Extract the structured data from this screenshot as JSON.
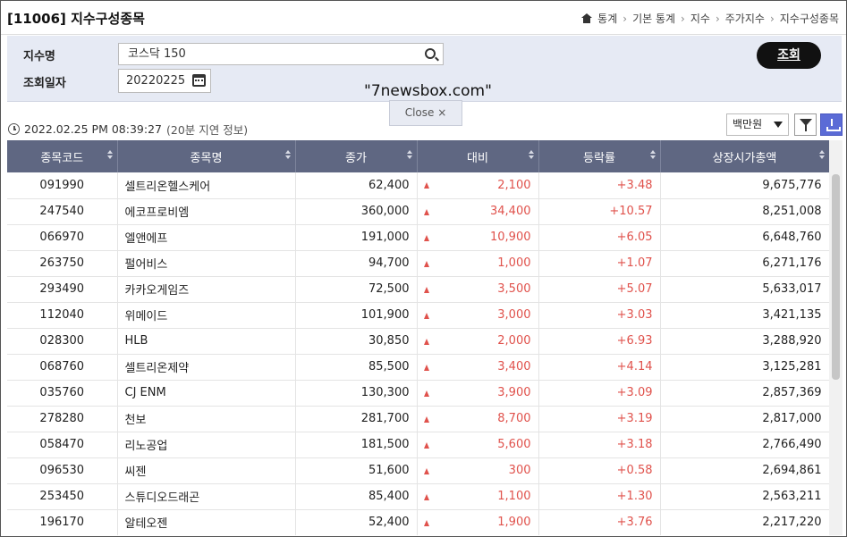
{
  "header": {
    "title": "[11006] 지수구성종목",
    "breadcrumb": [
      "통계",
      "기본 통계",
      "지수",
      "주가지수",
      "지수구성종목"
    ]
  },
  "search": {
    "index_label": "지수명",
    "index_value": "코스닥 150",
    "date_label": "조회일자",
    "date_value": "20220225",
    "query_button": "조회"
  },
  "overlay": {
    "watermark": "\"7newsbox.com\"",
    "close_label": "Close ×"
  },
  "toolbar": {
    "timestamp": "2022.02.25 PM 08:39:27",
    "delay_note": "(20분 지연 정보)",
    "unit_value": "백만원"
  },
  "table": {
    "columns": [
      "종목코드",
      "종목명",
      "종가",
      "대비",
      "등락률",
      "상장시가총액"
    ],
    "rows": [
      [
        "091990",
        "셀트리온헬스케어",
        "62,400",
        "2,100",
        "+3.48",
        "9,675,776"
      ],
      [
        "247540",
        "에코프로비엠",
        "360,000",
        "34,400",
        "+10.57",
        "8,251,008"
      ],
      [
        "066970",
        "엘앤에프",
        "191,000",
        "10,900",
        "+6.05",
        "6,648,760"
      ],
      [
        "263750",
        "펄어비스",
        "94,700",
        "1,000",
        "+1.07",
        "6,271,176"
      ],
      [
        "293490",
        "카카오게임즈",
        "72,500",
        "3,500",
        "+5.07",
        "5,633,017"
      ],
      [
        "112040",
        "위메이드",
        "101,900",
        "3,000",
        "+3.03",
        "3,421,135"
      ],
      [
        "028300",
        "HLB",
        "30,850",
        "2,000",
        "+6.93",
        "3,288,920"
      ],
      [
        "068760",
        "셀트리온제약",
        "85,500",
        "3,400",
        "+4.14",
        "3,125,281"
      ],
      [
        "035760",
        "CJ ENM",
        "130,300",
        "3,900",
        "+3.09",
        "2,857,369"
      ],
      [
        "278280",
        "천보",
        "281,700",
        "8,700",
        "+3.19",
        "2,817,000"
      ],
      [
        "058470",
        "리노공업",
        "181,500",
        "5,600",
        "+3.18",
        "2,766,490"
      ],
      [
        "096530",
        "씨젠",
        "51,600",
        "300",
        "+0.58",
        "2,694,861"
      ],
      [
        "253450",
        "스튜디오드래곤",
        "85,400",
        "1,100",
        "+1.30",
        "2,563,211"
      ],
      [
        "196170",
        "알테오젠",
        "52,400",
        "1,900",
        "+3.76",
        "2,217,220"
      ]
    ]
  }
}
